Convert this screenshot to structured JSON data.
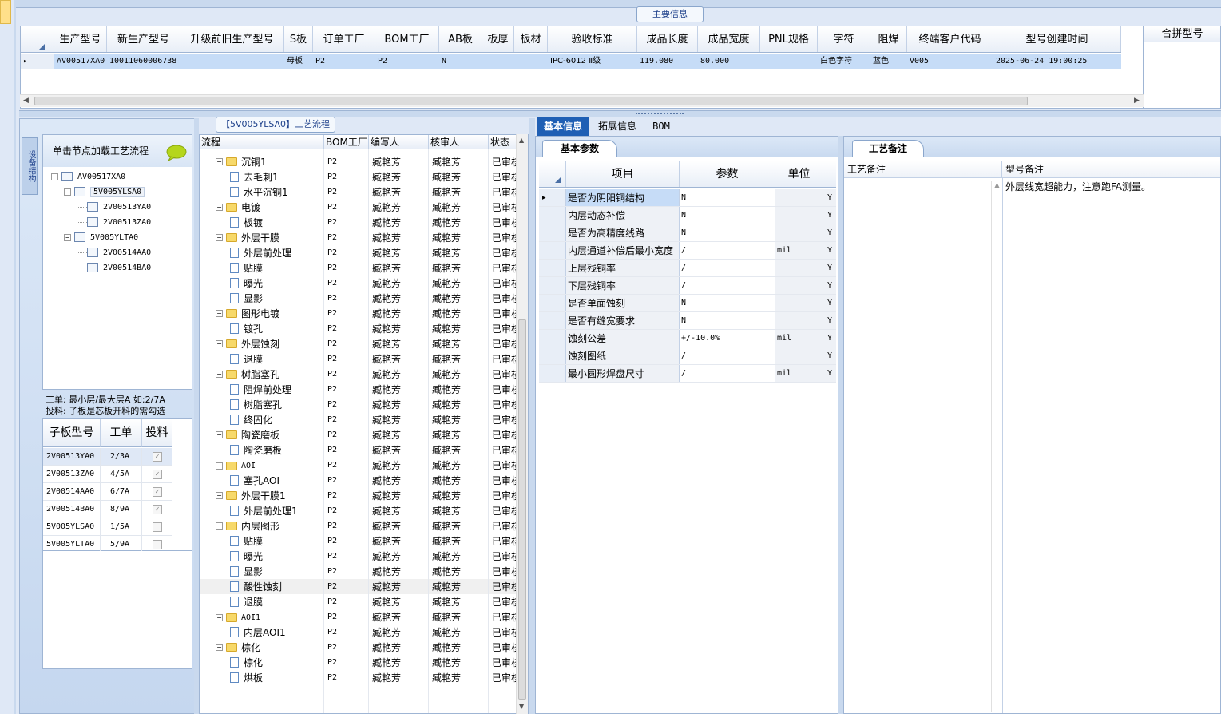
{
  "main_info": {
    "tab_label": "主要信息",
    "columns": [
      "生产型号",
      "新生产型号",
      "升级前旧生产型号",
      "S板",
      "订单工厂",
      "BOM工厂",
      "AB板",
      "板厚",
      "板材",
      "验收标准",
      "成品长度",
      "成品宽度",
      "PNL规格",
      "字符",
      "阻焊",
      "终端客户代码",
      "型号创建时间"
    ],
    "row": [
      "AV00517XA0",
      "10011060006738",
      "",
      "母板",
      "P2",
      "P2",
      "N",
      "",
      "",
      "IPC-6012 Ⅱ级",
      "119.080",
      "80.000",
      "",
      "白色字符",
      "蓝色",
      "V005",
      "2025-06-24 19:00:25"
    ],
    "merge_label": "合拼型号"
  },
  "left": {
    "vertical_tab": "设备结构",
    "tree_header": "单击节点加载工艺流程",
    "tree": [
      {
        "label": "AV00517XA0",
        "level": 0,
        "expanded": true
      },
      {
        "label": "5V005YLSA0",
        "level": 1,
        "expanded": true,
        "selected": true
      },
      {
        "label": "2V00513YA0",
        "level": 2
      },
      {
        "label": "2V00513ZA0",
        "level": 2
      },
      {
        "label": "5V005YLTA0",
        "level": 1,
        "expanded": true
      },
      {
        "label": "2V00514AA0",
        "level": 2
      },
      {
        "label": "2V00514BA0",
        "level": 2
      }
    ],
    "note_line1": "工单: 最小层/最大层A 如:2/7A",
    "note_line2": "投料: 子板是芯板开料的需勾选",
    "sub_columns": [
      "子板型号",
      "工单",
      "投料"
    ],
    "sub_rows": [
      {
        "model": "2V00513YA0",
        "order": "2/3A",
        "feed": true
      },
      {
        "model": "2V00513ZA0",
        "order": "4/5A",
        "feed": true
      },
      {
        "model": "2V00514AA0",
        "order": "6/7A",
        "feed": true
      },
      {
        "model": "2V00514BA0",
        "order": "8/9A",
        "feed": true
      },
      {
        "model": "5V005YLSA0",
        "order": "1/5A",
        "feed": false
      },
      {
        "model": "5V005YLTA0",
        "order": "5/9A",
        "feed": false
      }
    ]
  },
  "flow": {
    "title": "【5V005YLSA0】工艺流程",
    "columns": [
      "流程",
      "BOM工厂",
      "编写人",
      "核审人",
      "状态"
    ],
    "factory": "P2",
    "writer": "臧艳芳",
    "reviewer": "臧艳芳",
    "status": "已审核",
    "rows": [
      {
        "name": "沉铜1",
        "type": "folder"
      },
      {
        "name": "去毛刺1",
        "type": "doc"
      },
      {
        "name": "水平沉铜1",
        "type": "doc"
      },
      {
        "name": "电镀",
        "type": "folder"
      },
      {
        "name": "板镀",
        "type": "doc"
      },
      {
        "name": "外层干膜",
        "type": "folder"
      },
      {
        "name": "外层前处理",
        "type": "doc"
      },
      {
        "name": "贴膜",
        "type": "doc"
      },
      {
        "name": "曝光",
        "type": "doc"
      },
      {
        "name": "显影",
        "type": "doc"
      },
      {
        "name": "图形电镀",
        "type": "folder"
      },
      {
        "name": "镀孔",
        "type": "doc"
      },
      {
        "name": "外层蚀刻",
        "type": "folder"
      },
      {
        "name": "退膜",
        "type": "doc"
      },
      {
        "name": "树脂塞孔",
        "type": "folder"
      },
      {
        "name": "阻焊前处理",
        "type": "doc"
      },
      {
        "name": "树脂塞孔",
        "type": "doc"
      },
      {
        "name": "终固化",
        "type": "doc"
      },
      {
        "name": "陶瓷磨板",
        "type": "folder"
      },
      {
        "name": "陶瓷磨板",
        "type": "doc"
      },
      {
        "name": "AOI",
        "type": "folder"
      },
      {
        "name": "塞孔AOI",
        "type": "doc"
      },
      {
        "name": "外层干膜1",
        "type": "folder"
      },
      {
        "name": "外层前处理1",
        "type": "doc"
      },
      {
        "name": "内层图形",
        "type": "folder"
      },
      {
        "name": "贴膜",
        "type": "doc"
      },
      {
        "name": "曝光",
        "type": "doc"
      },
      {
        "name": "显影",
        "type": "doc"
      },
      {
        "name": "酸性蚀刻",
        "type": "doc",
        "selected": true
      },
      {
        "name": "退膜",
        "type": "doc"
      },
      {
        "name": "AOI1",
        "type": "folder"
      },
      {
        "name": "内层AOI1",
        "type": "doc"
      },
      {
        "name": "棕化",
        "type": "folder"
      },
      {
        "name": "棕化",
        "type": "doc"
      },
      {
        "name": "烘板",
        "type": "doc"
      }
    ]
  },
  "right": {
    "tabs": [
      "基本信息",
      "拓展信息",
      "BOM"
    ],
    "basic_tab": "基本参数",
    "param_columns": [
      "项目",
      "参数",
      "单位"
    ],
    "params": [
      {
        "item": "是否为阴阳铜结构",
        "value": "N",
        "unit": "",
        "flag": "Y"
      },
      {
        "item": "内层动态补偿",
        "value": "N",
        "unit": "",
        "flag": "Y"
      },
      {
        "item": "是否为高精度线路",
        "value": "N",
        "unit": "",
        "flag": "Y"
      },
      {
        "item": "内层通道补偿后最小宽度",
        "value": "/",
        "unit": "mil",
        "flag": "Y"
      },
      {
        "item": "上层残铜率",
        "value": "/",
        "unit": "",
        "flag": "Y"
      },
      {
        "item": "下层残铜率",
        "value": "/",
        "unit": "",
        "flag": "Y"
      },
      {
        "item": "是否单面蚀刻",
        "value": "N",
        "unit": "",
        "flag": "Y"
      },
      {
        "item": "是否有缝宽要求",
        "value": "N",
        "unit": "",
        "flag": "Y"
      },
      {
        "item": "蚀刻公差",
        "value": "+/-10.0%",
        "unit": "mil",
        "flag": "Y"
      },
      {
        "item": "蚀刻图纸",
        "value": "/",
        "unit": "",
        "flag": "Y"
      },
      {
        "item": "最小圆形焊盘尺寸",
        "value": "/",
        "unit": "mil",
        "flag": "Y"
      }
    ],
    "remark_tab": "工艺备注",
    "remark_col1": "工艺备注",
    "remark_col2": "型号备注",
    "model_remark": "外层线宽超能力，注意跑FA测量。"
  }
}
